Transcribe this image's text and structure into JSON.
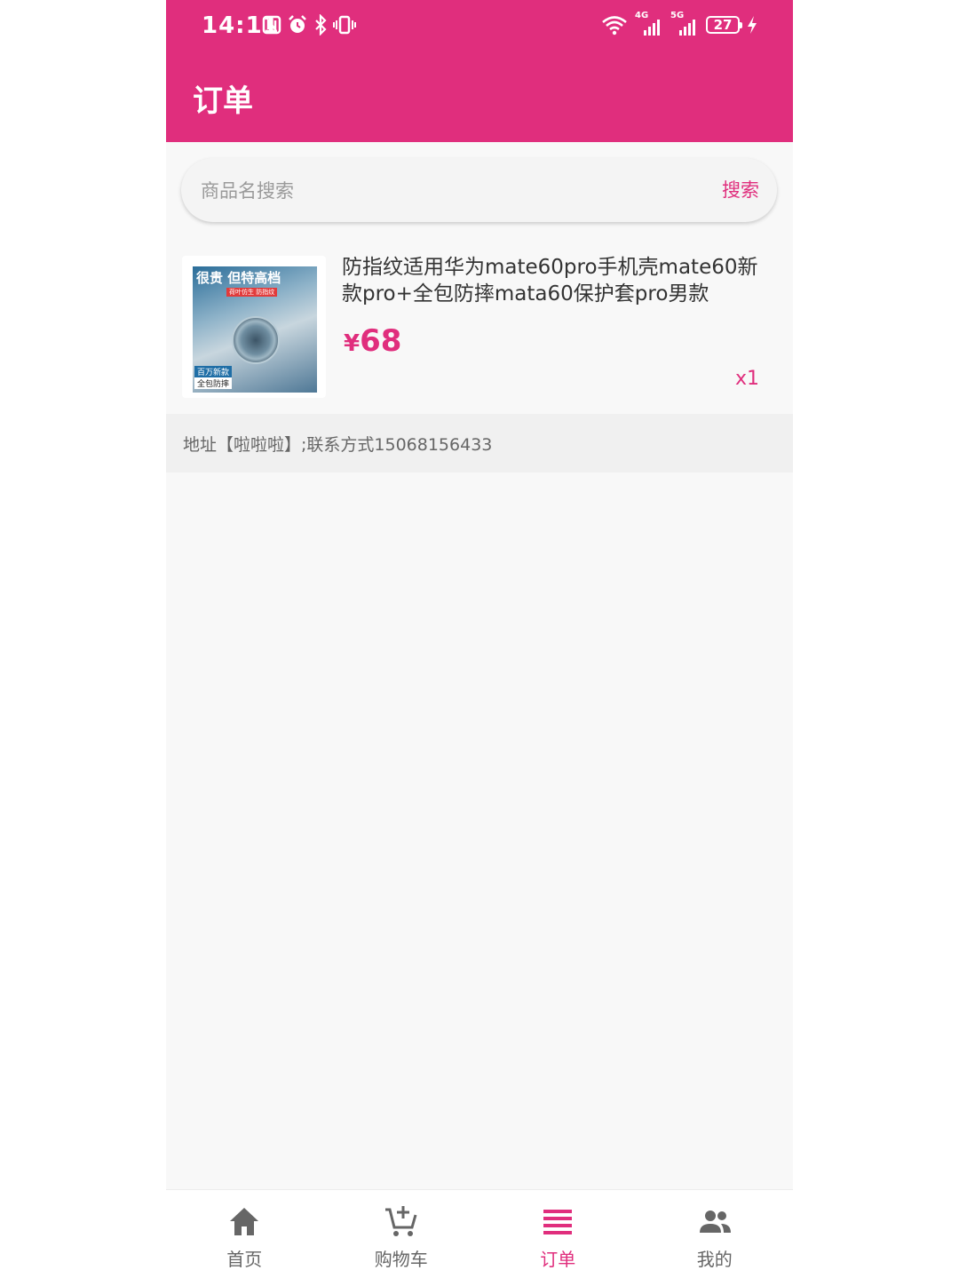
{
  "status_bar": {
    "time": "14:11",
    "battery": "27",
    "network_1": "4G",
    "network_2": "5G"
  },
  "header": {
    "title": "订单"
  },
  "search": {
    "placeholder": "商品名搜索",
    "button_label": "搜索"
  },
  "order": {
    "thumbnail_text": {
      "headline": "很贵 但特高档",
      "subline": "荷叶仿生 防指纹",
      "badge_1": "百万新款",
      "badge_2": "全包防摔"
    },
    "product_title": "防指纹适用华为mate60pro手机壳mate60新款pro+全包防摔mata60保护套pro男款",
    "currency": "¥",
    "price": "68",
    "quantity": "x1"
  },
  "address": {
    "text": "地址【啦啦啦】;联系方式15068156433"
  },
  "bottom_nav": {
    "items": [
      {
        "label": "首页",
        "icon": "home-icon",
        "active": false
      },
      {
        "label": "购物车",
        "icon": "cart-add-icon",
        "active": false
      },
      {
        "label": "订单",
        "icon": "list-icon",
        "active": true
      },
      {
        "label": "我的",
        "icon": "people-icon",
        "active": false
      }
    ]
  },
  "colors": {
    "primary": "#e02e7d",
    "inactive": "#666666",
    "background": "#f8f8f8"
  }
}
